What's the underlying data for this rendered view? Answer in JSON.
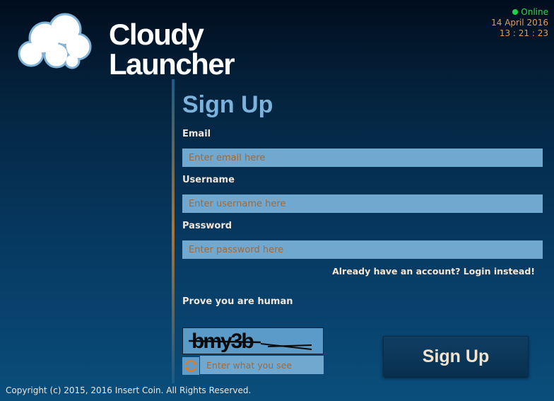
{
  "app": {
    "name_line1": "Cloudy",
    "name_line2": "Launcher"
  },
  "status": {
    "label": "Online",
    "date": "14 April 2016",
    "time": "13 : 21 : 23"
  },
  "form": {
    "title": "Sign Up",
    "email": {
      "label": "Email",
      "placeholder": "Enter email here",
      "value": ""
    },
    "username": {
      "label": "Username",
      "placeholder": "Enter username here",
      "value": ""
    },
    "password": {
      "label": "Password",
      "placeholder": "Enter password here",
      "value": ""
    },
    "login_link": "Already have an account? Login instead!",
    "captcha": {
      "label": "Prove you are human",
      "image_text": "bmy3b",
      "placeholder": "Enter what you see",
      "value": ""
    },
    "submit_label": "Sign Up"
  },
  "footer": {
    "copyright": "Copyright (c) 2015, 2016 Insert Coin. All Rights Reserved."
  },
  "icons": {
    "logo": "cloud-icon",
    "refresh": "refresh-icon",
    "status": "status-dot-icon"
  },
  "colors": {
    "accent": "#7cb3dc",
    "input_bg": "#70a8cf",
    "placeholder": "#a06a3a",
    "online": "#1fd14a",
    "date": "#e39c5a"
  }
}
